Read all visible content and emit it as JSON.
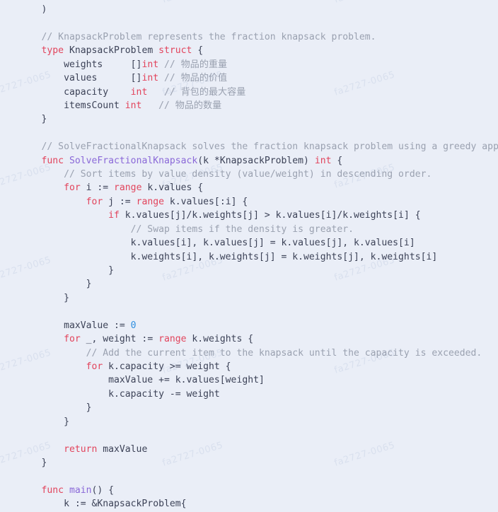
{
  "editor": {
    "language": "go",
    "background_color": "#eaeef7",
    "text_color": "#3c4257",
    "font_size_px": 13,
    "line_height_px": 19.4
  },
  "watermark": {
    "text": "fa2727-0065",
    "color": "#d9e0ee",
    "rotation_deg": -17
  },
  "syntax_colors": {
    "keyword": "#e2445c",
    "type": "#e2445c",
    "function": "#8a68d8",
    "comment": "#9aa1b0",
    "number": "#2f8fe0",
    "plain": "#3c4257"
  },
  "code": {
    "lines": [
      [
        {
          "t": "plain",
          "s": "    )"
        }
      ],
      [
        {
          "t": "plain",
          "s": ""
        }
      ],
      [
        {
          "t": "comment",
          "s": "    // KnapsackProblem represents the fraction knapsack problem."
        }
      ],
      [
        {
          "t": "keyword",
          "s": "    type"
        },
        {
          "t": "plain",
          "s": " KnapsackProblem "
        },
        {
          "t": "keyword",
          "s": "struct"
        },
        {
          "t": "plain",
          "s": " {"
        }
      ],
      [
        {
          "t": "plain",
          "s": "        weights     []"
        },
        {
          "t": "type",
          "s": "int"
        },
        {
          "t": "plain",
          "s": " "
        },
        {
          "t": "comment",
          "s": "// 物品的重量"
        }
      ],
      [
        {
          "t": "plain",
          "s": "        values      []"
        },
        {
          "t": "type",
          "s": "int"
        },
        {
          "t": "plain",
          "s": " "
        },
        {
          "t": "comment",
          "s": "// 物品的价值"
        }
      ],
      [
        {
          "t": "plain",
          "s": "        capacity    "
        },
        {
          "t": "type",
          "s": "int"
        },
        {
          "t": "plain",
          "s": "   "
        },
        {
          "t": "comment",
          "s": "// 背包的最大容量"
        }
      ],
      [
        {
          "t": "plain",
          "s": "        itemsCount "
        },
        {
          "t": "type",
          "s": "int"
        },
        {
          "t": "plain",
          "s": "   "
        },
        {
          "t": "comment",
          "s": "// 物品的数量"
        }
      ],
      [
        {
          "t": "plain",
          "s": "    }"
        }
      ],
      [
        {
          "t": "plain",
          "s": ""
        }
      ],
      [
        {
          "t": "comment",
          "s": "    // SolveFractionalKnapsack solves the fraction knapsack problem using a greedy approach."
        }
      ],
      [
        {
          "t": "keyword",
          "s": "    func"
        },
        {
          "t": "plain",
          "s": " "
        },
        {
          "t": "function",
          "s": "SolveFractionalKnapsack"
        },
        {
          "t": "plain",
          "s": "(k *KnapsackProblem) "
        },
        {
          "t": "type",
          "s": "int"
        },
        {
          "t": "plain",
          "s": " {"
        }
      ],
      [
        {
          "t": "comment",
          "s": "        // Sort items by value density (value/weight) in descending order."
        }
      ],
      [
        {
          "t": "keyword",
          "s": "        for"
        },
        {
          "t": "plain",
          "s": " i := "
        },
        {
          "t": "keyword",
          "s": "range"
        },
        {
          "t": "plain",
          "s": " k.values {"
        }
      ],
      [
        {
          "t": "keyword",
          "s": "            for"
        },
        {
          "t": "plain",
          "s": " j := "
        },
        {
          "t": "keyword",
          "s": "range"
        },
        {
          "t": "plain",
          "s": " k.values[:i] {"
        }
      ],
      [
        {
          "t": "keyword",
          "s": "                if"
        },
        {
          "t": "plain",
          "s": " k.values[j]/k.weights[j] > k.values[i]/k.weights[i] {"
        }
      ],
      [
        {
          "t": "comment",
          "s": "                    // Swap items if the density is greater."
        }
      ],
      [
        {
          "t": "plain",
          "s": "                    k.values[i], k.values[j] = k.values[j], k.values[i]"
        }
      ],
      [
        {
          "t": "plain",
          "s": "                    k.weights[i], k.weights[j] = k.weights[j], k.weights[i]"
        }
      ],
      [
        {
          "t": "plain",
          "s": "                }"
        }
      ],
      [
        {
          "t": "plain",
          "s": "            }"
        }
      ],
      [
        {
          "t": "plain",
          "s": "        }"
        }
      ],
      [
        {
          "t": "plain",
          "s": ""
        }
      ],
      [
        {
          "t": "plain",
          "s": "        maxValue := "
        },
        {
          "t": "number",
          "s": "0"
        }
      ],
      [
        {
          "t": "keyword",
          "s": "        for"
        },
        {
          "t": "plain",
          "s": " _, weight := "
        },
        {
          "t": "keyword",
          "s": "range"
        },
        {
          "t": "plain",
          "s": " k.weights {"
        }
      ],
      [
        {
          "t": "comment",
          "s": "            // Add the current item to the knapsack until the capacity is exceeded."
        }
      ],
      [
        {
          "t": "keyword",
          "s": "            for"
        },
        {
          "t": "plain",
          "s": " k.capacity >= weight {"
        }
      ],
      [
        {
          "t": "plain",
          "s": "                maxValue += k.values[weight]"
        }
      ],
      [
        {
          "t": "plain",
          "s": "                k.capacity -= weight"
        }
      ],
      [
        {
          "t": "plain",
          "s": "            }"
        }
      ],
      [
        {
          "t": "plain",
          "s": "        }"
        }
      ],
      [
        {
          "t": "plain",
          "s": ""
        }
      ],
      [
        {
          "t": "keyword",
          "s": "        return"
        },
        {
          "t": "plain",
          "s": " maxValue"
        }
      ],
      [
        {
          "t": "plain",
          "s": "    }"
        }
      ],
      [
        {
          "t": "plain",
          "s": ""
        }
      ],
      [
        {
          "t": "keyword",
          "s": "    func"
        },
        {
          "t": "plain",
          "s": " "
        },
        {
          "t": "function",
          "s": "main"
        },
        {
          "t": "plain",
          "s": "() {"
        }
      ],
      [
        {
          "t": "plain",
          "s": "        k := &KnapsackProblem{"
        }
      ]
    ]
  }
}
